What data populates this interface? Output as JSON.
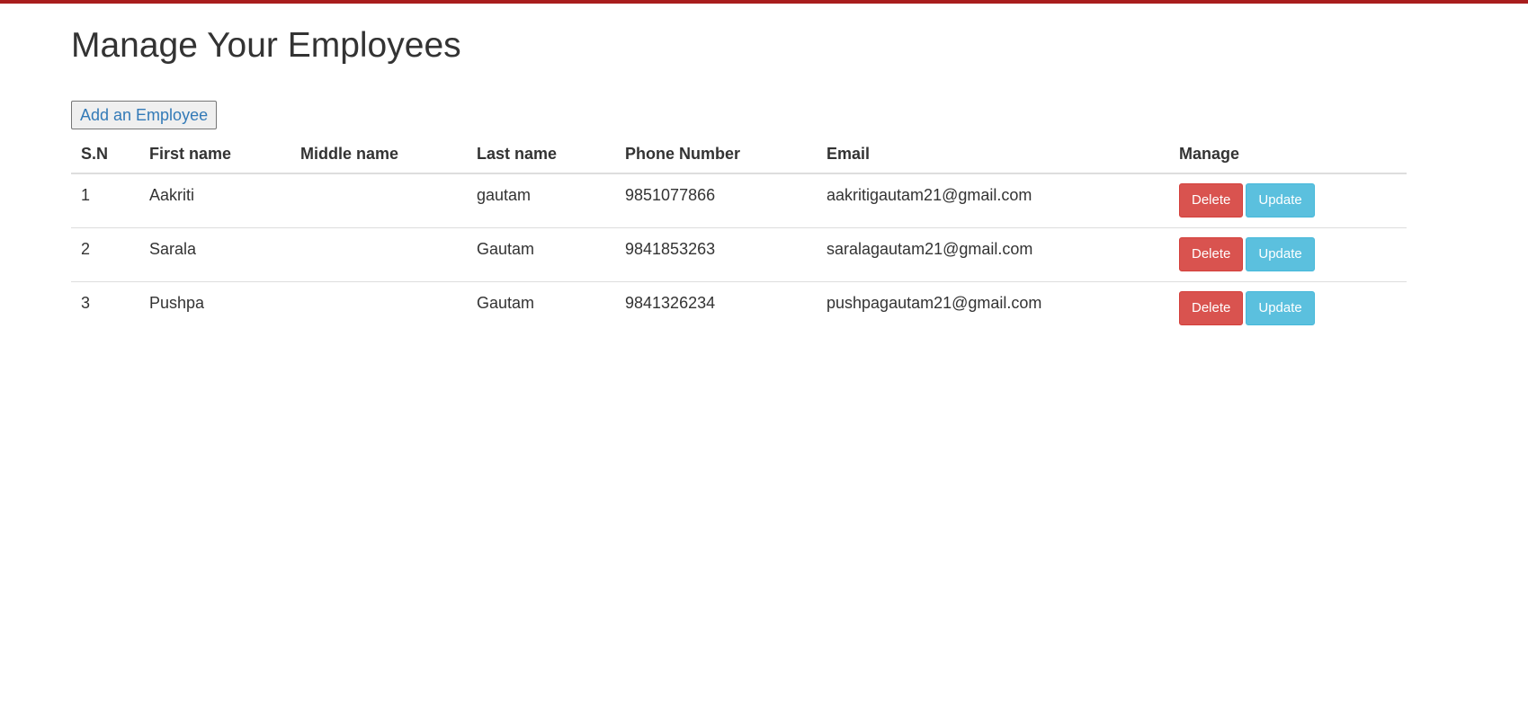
{
  "header": {
    "title": "Manage Your Employees",
    "accent_color": "#a81d1d"
  },
  "toolbar": {
    "add_label": "Add an Employee"
  },
  "table": {
    "columns": [
      "S.N",
      "First name",
      "Middle name",
      "Last name",
      "Phone Number",
      "Email",
      "Manage"
    ],
    "rows": [
      {
        "sn": "1",
        "first": "Aakriti",
        "middle": "",
        "last": "gautam",
        "phone": "9851077866",
        "email": "aakritigautam21@gmail.com"
      },
      {
        "sn": "2",
        "first": "Sarala",
        "middle": "",
        "last": "Gautam",
        "phone": "9841853263",
        "email": "saralagautam21@gmail.com"
      },
      {
        "sn": "3",
        "first": "Pushpa",
        "middle": "",
        "last": "Gautam",
        "phone": "9841326234",
        "email": "pushpagautam21@gmail.com"
      }
    ],
    "delete_label": "Delete",
    "update_label": "Update",
    "delete_color": "#d9534f",
    "update_color": "#5bc0de"
  }
}
